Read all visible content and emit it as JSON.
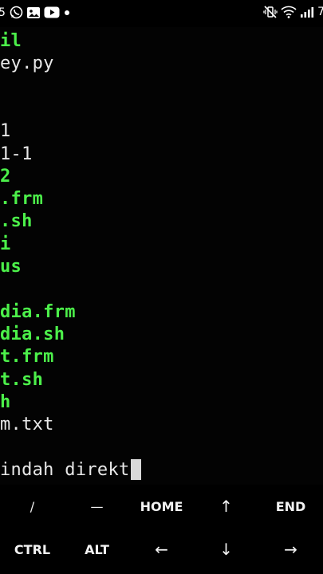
{
  "status_bar": {
    "left_clock_fragment": "5",
    "right_clock_fragment": "7",
    "left_icons": [
      "whatsapp-icon",
      "gallery-icon",
      "youtube-icon",
      "notification-dot-icon"
    ],
    "right_icons": [
      "mute-vibrate-icon",
      "wifi-icon",
      "signal-icon"
    ]
  },
  "terminal": {
    "lines": [
      {
        "text": "il",
        "color": "green"
      },
      {
        "text": "ey.py",
        "color": "white"
      },
      {
        "text": "",
        "color": "white"
      },
      {
        "text": "",
        "color": "white"
      },
      {
        "text": "1",
        "color": "white"
      },
      {
        "text": "1-1",
        "color": "white"
      },
      {
        "text": "2",
        "color": "green"
      },
      {
        "text": ".frm",
        "color": "green"
      },
      {
        "text": ".sh",
        "color": "green"
      },
      {
        "text": "i",
        "color": "green"
      },
      {
        "text": "us",
        "color": "green"
      },
      {
        "text": "",
        "color": "white"
      },
      {
        "text": "dia.frm",
        "color": "green"
      },
      {
        "text": "dia.sh",
        "color": "green"
      },
      {
        "text": "t.frm",
        "color": "green"
      },
      {
        "text": "t.sh",
        "color": "green"
      },
      {
        "text": "h",
        "color": "green"
      },
      {
        "text": "m.txt",
        "color": "white"
      },
      {
        "text": "",
        "color": "white"
      },
      {
        "text": "indah direkt",
        "color": "white",
        "cursor": true
      }
    ]
  },
  "extra_keys": {
    "row1": [
      "/",
      "—",
      "HOME",
      "↑",
      "END"
    ],
    "row2": [
      "CTRL",
      "ALT",
      "←",
      "↓",
      "→"
    ]
  }
}
